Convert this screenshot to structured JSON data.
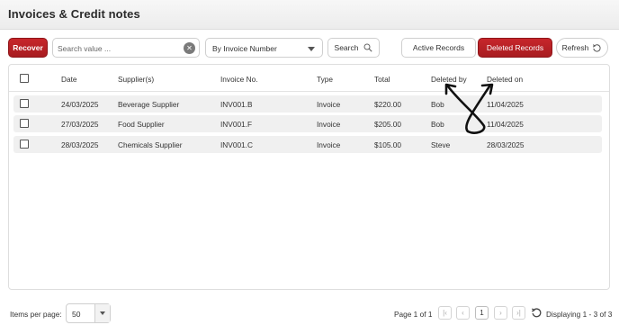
{
  "header": {
    "title": "Invoices & Credit notes"
  },
  "toolbar": {
    "recover_label": "Recover",
    "search_placeholder": "Search value ...",
    "search_by": "By Invoice Number",
    "search_label": "Search",
    "active_label": "Active Records",
    "deleted_label": "Deleted Records",
    "refresh_label": "Refresh"
  },
  "table": {
    "headers": [
      "Date",
      "Supplier(s)",
      "Invoice No.",
      "Type",
      "Total",
      "Deleted by",
      "Deleted on"
    ],
    "rows": [
      {
        "date": "24/03/2025",
        "supplier": "Beverage Supplier",
        "invoice": "INV001.B",
        "type": "Invoice",
        "total": "$220.00",
        "deleted_by": "Bob",
        "deleted_on": "11/04/2025"
      },
      {
        "date": "27/03/2025",
        "supplier": "Food Supplier",
        "invoice": "INV001.F",
        "type": "Invoice",
        "total": "$205.00",
        "deleted_by": "Bob",
        "deleted_on": "11/04/2025"
      },
      {
        "date": "28/03/2025",
        "supplier": "Chemicals Supplier",
        "invoice": "INV001.C",
        "type": "Invoice",
        "total": "$105.00",
        "deleted_by": "Steve",
        "deleted_on": "28/03/2025"
      }
    ]
  },
  "footer": {
    "items_per_page_label": "Items per page:",
    "items_per_page": "50",
    "page_info": "Page 1 of 1",
    "current_page": "1",
    "displaying": "Displaying 1 - 3 of 3"
  },
  "colors": {
    "accent": "#b32025",
    "row_bg": "#f0f0f0"
  },
  "icons": [
    "clear-icon",
    "search-icon",
    "chevron-down-icon",
    "refresh-icon",
    "first-page-icon",
    "prev-page-icon",
    "next-page-icon",
    "last-page-icon",
    "resize-arrows-icon"
  ]
}
